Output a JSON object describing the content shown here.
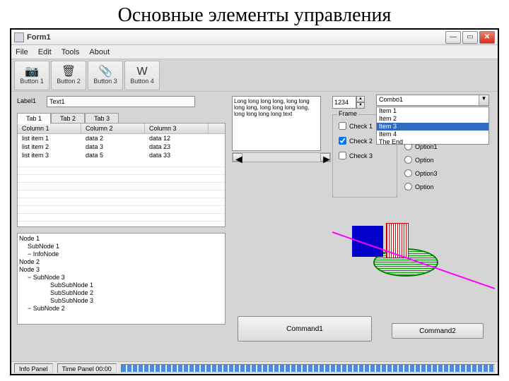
{
  "slide_title": "Основные элементы управления",
  "window": {
    "title": "Form1"
  },
  "menubar": [
    "File",
    "Edit",
    "Tools",
    "About"
  ],
  "toolbar": [
    {
      "label": "Button 1",
      "icon": "📷"
    },
    {
      "label": "Button 2",
      "icon": "🗑"
    },
    {
      "label": "Button 3",
      "icon": "📎"
    },
    {
      "label": "Button 4",
      "icon": "W"
    }
  ],
  "label1": "Label1",
  "text1": "Text1",
  "tabs": [
    "Tab 1",
    "Tab 2",
    "Tab 3"
  ],
  "listview": {
    "columns": [
      "Column 1",
      "Column 2",
      "Column 3"
    ],
    "rows": [
      [
        "list item 1",
        "data 2",
        "data 12"
      ],
      [
        "list item 2",
        "data 3",
        "data 23"
      ],
      [
        "list item 3",
        "data 5",
        "data 33"
      ]
    ]
  },
  "tree": [
    "Node 1",
    "  SubNode 1",
    "  − InfoNode",
    "Node 2",
    "Node 3",
    "  − SubNode 3",
    "      SubSubNode 1",
    "      SubSubNode 2",
    "      SubSubNode 3",
    "  − SubNode 2"
  ],
  "scrolltext": "Long long long long, long long long long, long long long long, long long long long text",
  "spin_value": "1234",
  "frame_label": "Frame",
  "checks": [
    {
      "label": "Check 1",
      "checked": false
    },
    {
      "label": "Check 2",
      "checked": true
    },
    {
      "label": "Check 3",
      "checked": false
    }
  ],
  "radios": [
    "Option1",
    "Option",
    "Option3",
    "Option"
  ],
  "combo_value": "Combo1",
  "listbox_items": [
    "Item 1",
    "Item 2",
    "Item 3",
    "Item 4",
    "The End"
  ],
  "listbox_selected": 2,
  "cmd1": "Command1",
  "cmd2": "Command2",
  "status": {
    "info": "Info Panel",
    "time": "Time Panel 00:00"
  }
}
